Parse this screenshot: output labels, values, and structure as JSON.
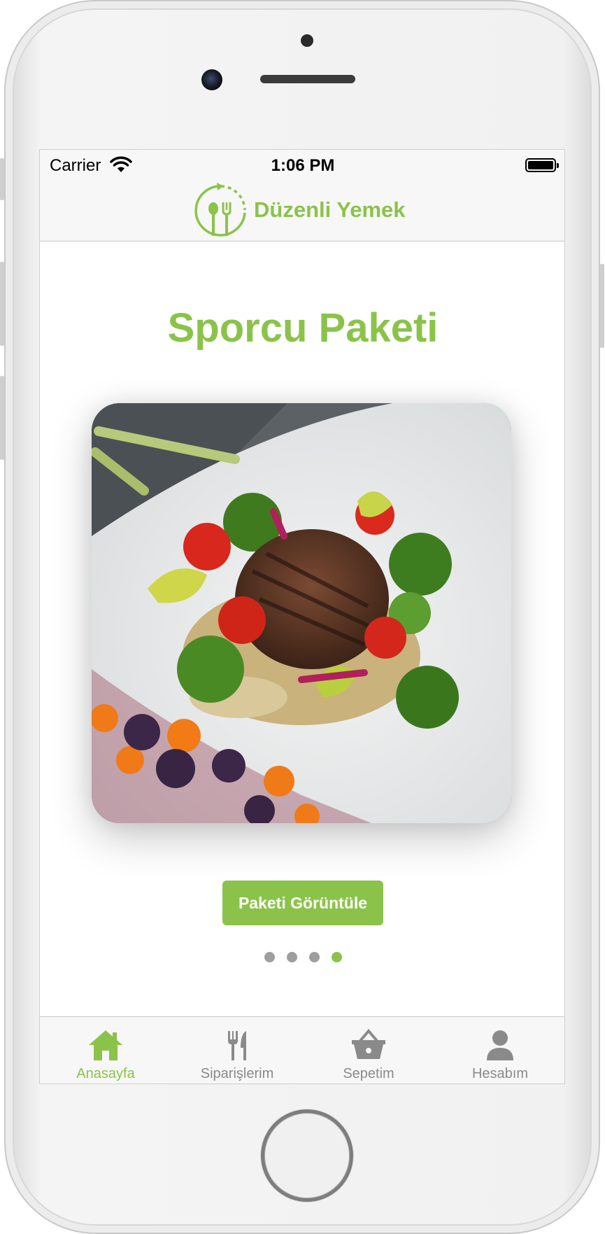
{
  "status_bar": {
    "carrier": "Carrier",
    "time": "1:06 PM"
  },
  "header": {
    "logo_text": "Düzenli Yemek"
  },
  "main": {
    "title": "Sporcu Paketi",
    "image_alt": "Grilled steak with vegetables",
    "button_label": "Paketi Görüntüle",
    "page_count": 4,
    "active_page": 4
  },
  "tab_bar": {
    "tabs": [
      {
        "label": "Anasayfa",
        "icon": "home-icon",
        "active": true
      },
      {
        "label": "Siparişlerim",
        "icon": "fork-knife-icon",
        "active": false
      },
      {
        "label": "Sepetim",
        "icon": "basket-icon",
        "active": false
      },
      {
        "label": "Hesabım",
        "icon": "user-icon",
        "active": false
      }
    ]
  },
  "colors": {
    "accent": "#8bc34a",
    "inactive": "#8a8a8a"
  }
}
